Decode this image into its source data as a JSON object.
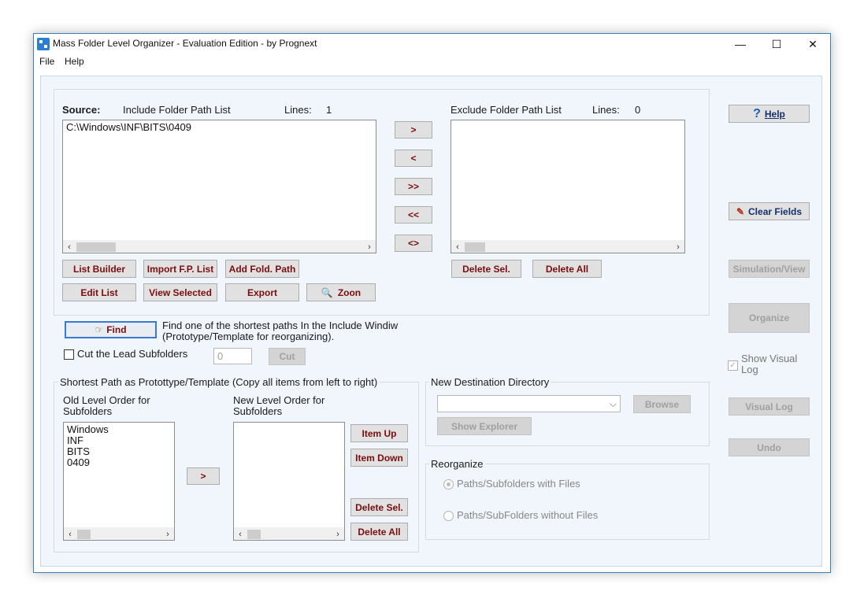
{
  "window": {
    "title": "Mass Folder Level Organizer - Evaluation Edition  -  by Prognext",
    "minimize": "—",
    "maximize": "☐",
    "close": "✕"
  },
  "menu": {
    "file": "File",
    "help": "Help"
  },
  "source": {
    "label": "Source:",
    "include_title": "Include Folder  Path List",
    "lines_label": "Lines:",
    "lines_count": "1",
    "items": [
      "C:\\Windows\\INF\\BITS\\0409"
    ]
  },
  "exclude": {
    "title": "Exclude Folder Path List",
    "lines_label": "Lines:",
    "lines_count": "0"
  },
  "transfer": {
    "move_right": ">",
    "move_left": "<",
    "move_all_right": ">>",
    "move_all_left": "<<",
    "swap": "<>"
  },
  "buttons": {
    "list_builder": "List Builder",
    "import_fp_list": "Import F.P. List",
    "add_fold_path": "Add Fold. Path",
    "edit_list": "Edit List",
    "view_selected": "View Selected",
    "export": "Export",
    "zoon": "Zoon",
    "delete_sel": "Delete Sel.",
    "delete_all": "Delete All",
    "find": "Find",
    "cut": "Cut",
    "item_up": "Item Up",
    "item_down": "Item Down",
    "delete_sel2": "Delete Sel.",
    "delete_all2": "Delete All",
    "move_level": ">",
    "browse": "Browse",
    "show_explorer": "Show Explorer"
  },
  "right_panel": {
    "help": "Help",
    "clear_fields": "Clear Fields",
    "simulation_view": "Simulation/View",
    "organize": "Organize",
    "show_visual_log": "Show Visual Log",
    "visual_log": "Visual Log",
    "undo": "Undo"
  },
  "find_desc": "Find one of the shortest paths In the Include Windiw (Prototype/Template for reorganizing).",
  "cut_lead": {
    "label": "Cut the Lead Subfolders",
    "value": "0",
    "checked": false
  },
  "shortest_path": {
    "group_title": "Shortest Path as Protottype/Template (Copy all items from left to right)",
    "old_label": "Old Level Order for Subfolders",
    "new_label": "New Level Order for Subfolders",
    "old_items": [
      "Windows",
      "INF",
      "BITS",
      "0409"
    ]
  },
  "destination": {
    "group_title": "New Destination Directory",
    "value": ""
  },
  "reorganize": {
    "group_title": "Reorganize",
    "with_files": "Paths/Subfolders with Files",
    "without_files": "Paths/SubFolders without Files",
    "selected": "with_files"
  }
}
